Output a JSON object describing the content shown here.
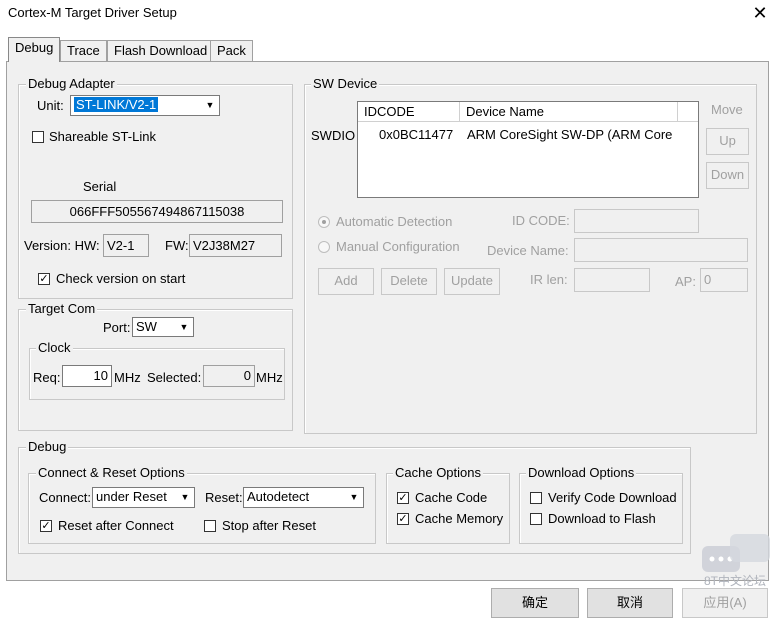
{
  "window": {
    "title": "Cortex-M Target Driver Setup",
    "close_glyph": "✕"
  },
  "tabs": [
    {
      "label": "Debug",
      "active": true
    },
    {
      "label": "Trace"
    },
    {
      "label": "Flash Download"
    },
    {
      "label": "Pack"
    }
  ],
  "debug_adapter": {
    "group_label": "Debug Adapter",
    "unit_label": "Unit:",
    "unit_value": "ST-LINK/V2-1",
    "shareable_label": "Shareable ST-Link",
    "shareable_checked": false,
    "serial_label": "Serial",
    "serial_value": "066FFF505567494867115038",
    "version_label": "Version: HW:",
    "hw_value": "V2-1",
    "fw_label": "FW:",
    "fw_value": "V2J38M27",
    "check_version_label": "Check version on start",
    "check_version_checked": true
  },
  "target_com": {
    "group_label": "Target Com",
    "port_label": "Port:",
    "port_value": "SW",
    "clock_label": "Clock",
    "req_label": "Req:",
    "req_value": "10",
    "req_unit": "MHz",
    "selected_label": "Selected:",
    "selected_value": "0",
    "selected_unit": "MHz"
  },
  "sw_device": {
    "group_label": "SW Device",
    "row_label": "SWDIO",
    "columns": [
      "IDCODE",
      "Device Name"
    ],
    "rows": [
      {
        "idcode": "0x0BC11477",
        "device_name": "ARM CoreSight SW-DP (ARM Core"
      }
    ],
    "move_label": "Move",
    "up_label": "Up",
    "down_label": "Down",
    "auto_detect_label": "Automatic Detection",
    "manual_config_label": "Manual Configuration",
    "id_code_label": "ID CODE:",
    "device_name_label": "Device Name:",
    "ir_len_label": "IR len:",
    "ap_label": "AP:",
    "ap_value": "0",
    "add_label": "Add",
    "delete_label": "Delete",
    "update_label": "Update"
  },
  "debug": {
    "group_label": "Debug",
    "connect_reset": {
      "group_label": "Connect & Reset Options",
      "connect_label": "Connect:",
      "connect_value": "under Reset",
      "reset_label": "Reset:",
      "reset_value": "Autodetect",
      "reset_after_connect_label": "Reset after Connect",
      "reset_after_connect_checked": true,
      "stop_after_reset_label": "Stop after Reset",
      "stop_after_reset_checked": false
    },
    "cache": {
      "group_label": "Cache Options",
      "cache_code_label": "Cache Code",
      "cache_code_checked": true,
      "cache_memory_label": "Cache Memory",
      "cache_memory_checked": true
    },
    "download": {
      "group_label": "Download Options",
      "verify_label": "Verify Code Download",
      "verify_checked": false,
      "download_flash_label": "Download to Flash",
      "download_flash_checked": false
    }
  },
  "footer": {
    "ok_label": "确定",
    "cancel_label": "取消",
    "apply_label": "应用(A)"
  },
  "watermark": {
    "text": "8T中文论坛",
    "icon": "chat-bubble-icon"
  },
  "colors": {
    "selection": "#0078d7",
    "panel_bg": "#f0f0f0",
    "disabled_text": "#a0a0a0"
  }
}
